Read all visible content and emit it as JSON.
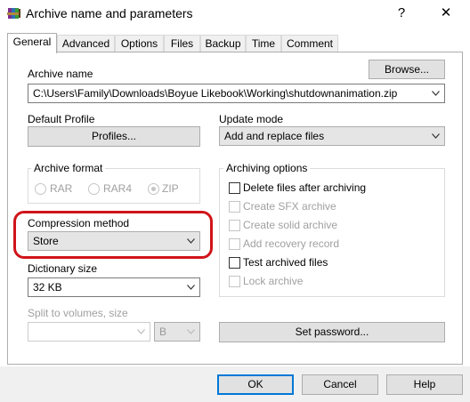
{
  "window": {
    "title": "Archive name and parameters",
    "help_glyph": "?",
    "close_glyph": "✕",
    "icon": "winrar-books-icon"
  },
  "tabs": [
    {
      "label": "General",
      "active": true
    },
    {
      "label": "Advanced",
      "active": false
    },
    {
      "label": "Options",
      "active": false
    },
    {
      "label": "Files",
      "active": false
    },
    {
      "label": "Backup",
      "active": false
    },
    {
      "label": "Time",
      "active": false
    },
    {
      "label": "Comment",
      "active": false
    }
  ],
  "general": {
    "archive_name_label": "Archive name",
    "browse_label": "Browse...",
    "archive_name_value": "C:\\Users\\Family\\Downloads\\Boyue Likebook\\Working\\shutdownanimation.zip",
    "default_profile_label": "Default Profile",
    "profiles_label": "Profiles...",
    "update_mode_label": "Update mode",
    "update_mode_value": "Add and replace files",
    "archive_format_label": "Archive format",
    "formats": [
      {
        "label": "RAR",
        "selected": false
      },
      {
        "label": "RAR4",
        "selected": false
      },
      {
        "label": "ZIP",
        "selected": true
      }
    ],
    "compression_label": "Compression method",
    "compression_value": "Store",
    "dictionary_label": "Dictionary size",
    "dictionary_value": "32 KB",
    "split_label": "Split to volumes, size",
    "split_value": "",
    "split_unit": "B",
    "archiving_options_label": "Archiving options",
    "options": [
      {
        "label": "Delete files after archiving",
        "checked": false,
        "enabled": true
      },
      {
        "label": "Create SFX archive",
        "checked": false,
        "enabled": false
      },
      {
        "label": "Create solid archive",
        "checked": false,
        "enabled": false
      },
      {
        "label": "Add recovery record",
        "checked": false,
        "enabled": false
      },
      {
        "label": "Test archived files",
        "checked": false,
        "enabled": true
      },
      {
        "label": "Lock archive",
        "checked": false,
        "enabled": false
      }
    ],
    "set_password_label": "Set password..."
  },
  "footer": {
    "ok_label": "OK",
    "cancel_label": "Cancel",
    "help_label": "Help"
  },
  "colors": {
    "highlight": "#d0141a",
    "default_button_border": "#0078d7"
  }
}
